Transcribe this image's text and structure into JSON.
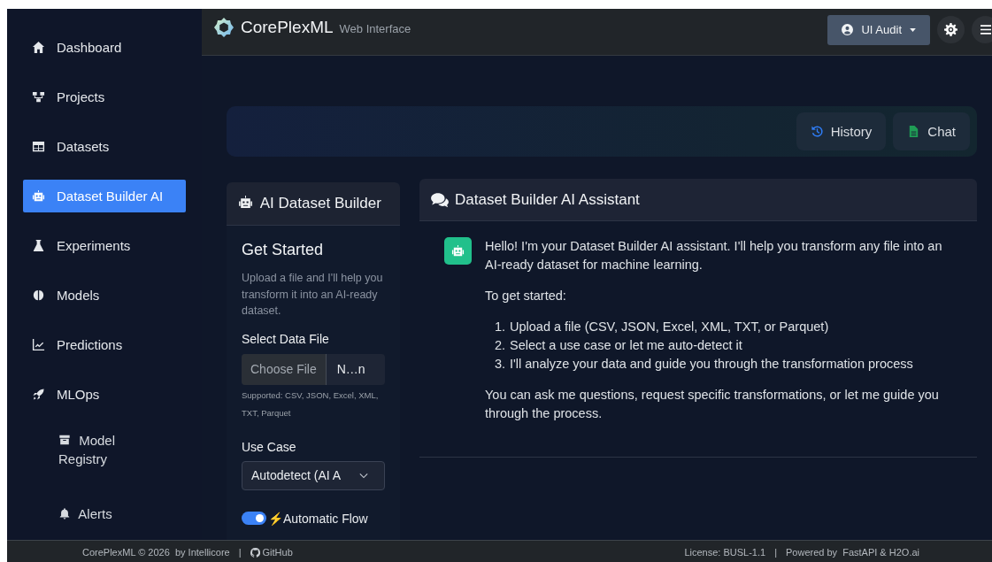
{
  "header": {
    "brand": "CorePlexML",
    "subtitle": "Web Interface",
    "user_menu": "UI Audit"
  },
  "sidebar": {
    "items": [
      {
        "label": "Dashboard",
        "selected": false
      },
      {
        "label": "Projects",
        "selected": false
      },
      {
        "label": "Datasets",
        "selected": false
      },
      {
        "label": "Dataset Builder AI",
        "selected": true
      },
      {
        "label": "Experiments",
        "selected": false
      },
      {
        "label": "Models",
        "selected": false
      },
      {
        "label": "Predictions",
        "selected": false
      },
      {
        "label": "MLOps",
        "selected": false,
        "children": [
          {
            "label": "Model Registry",
            "selected": false
          },
          {
            "label": "Alerts",
            "selected": false
          }
        ]
      }
    ]
  },
  "toolbar": {
    "buttons": [
      "History",
      "Chat"
    ]
  },
  "builder_panel": {
    "title": "AI Dataset Builder",
    "heading": "Get Started",
    "description": "Upload a file and I'll help you transform it into an AI-ready dataset.",
    "file_field": {
      "label": "Select Data File",
      "button": "Choose File",
      "value": "N…n",
      "hint": "Supported: CSV, JSON, Excel, XML, TXT, Parquet"
    },
    "use_case": {
      "label": "Use Case",
      "value": "Autodetect (AI A"
    },
    "toggle": {
      "label": "⚡Automatic Flow",
      "on": true
    }
  },
  "chat_panel": {
    "title": "Dataset Builder AI Assistant",
    "message": [
      {
        "kind": "paragraph",
        "text": "Hello! I'm your Dataset Builder AI assistant. I'll help you transform any file into an AI-ready dataset for machine learning."
      },
      {
        "kind": "paragraph",
        "text": "To get started:"
      },
      {
        "kind": "list",
        "items": [
          {
            "number": "1.",
            "text": "Upload a file (CSV, JSON, Excel, XML, TXT, or Parquet)"
          },
          {
            "number": "2.",
            "text": "Select a use case or let me auto-detect it"
          },
          {
            "number": "3.",
            "text": "I'll analyze your data and guide you through the transformation process"
          }
        ]
      },
      {
        "kind": "paragraph",
        "text": "You can ask me questions, request specific transformations, or let me guide you through the process."
      }
    ]
  },
  "footer": {
    "left": [
      "CorePlexML © 2026  by Intellicore",
      "|",
      "GitHub"
    ],
    "right": [
      "License: BUSL-1.1",
      "|",
      "Powered by  FastAPI & H2O.ai"
    ]
  }
}
